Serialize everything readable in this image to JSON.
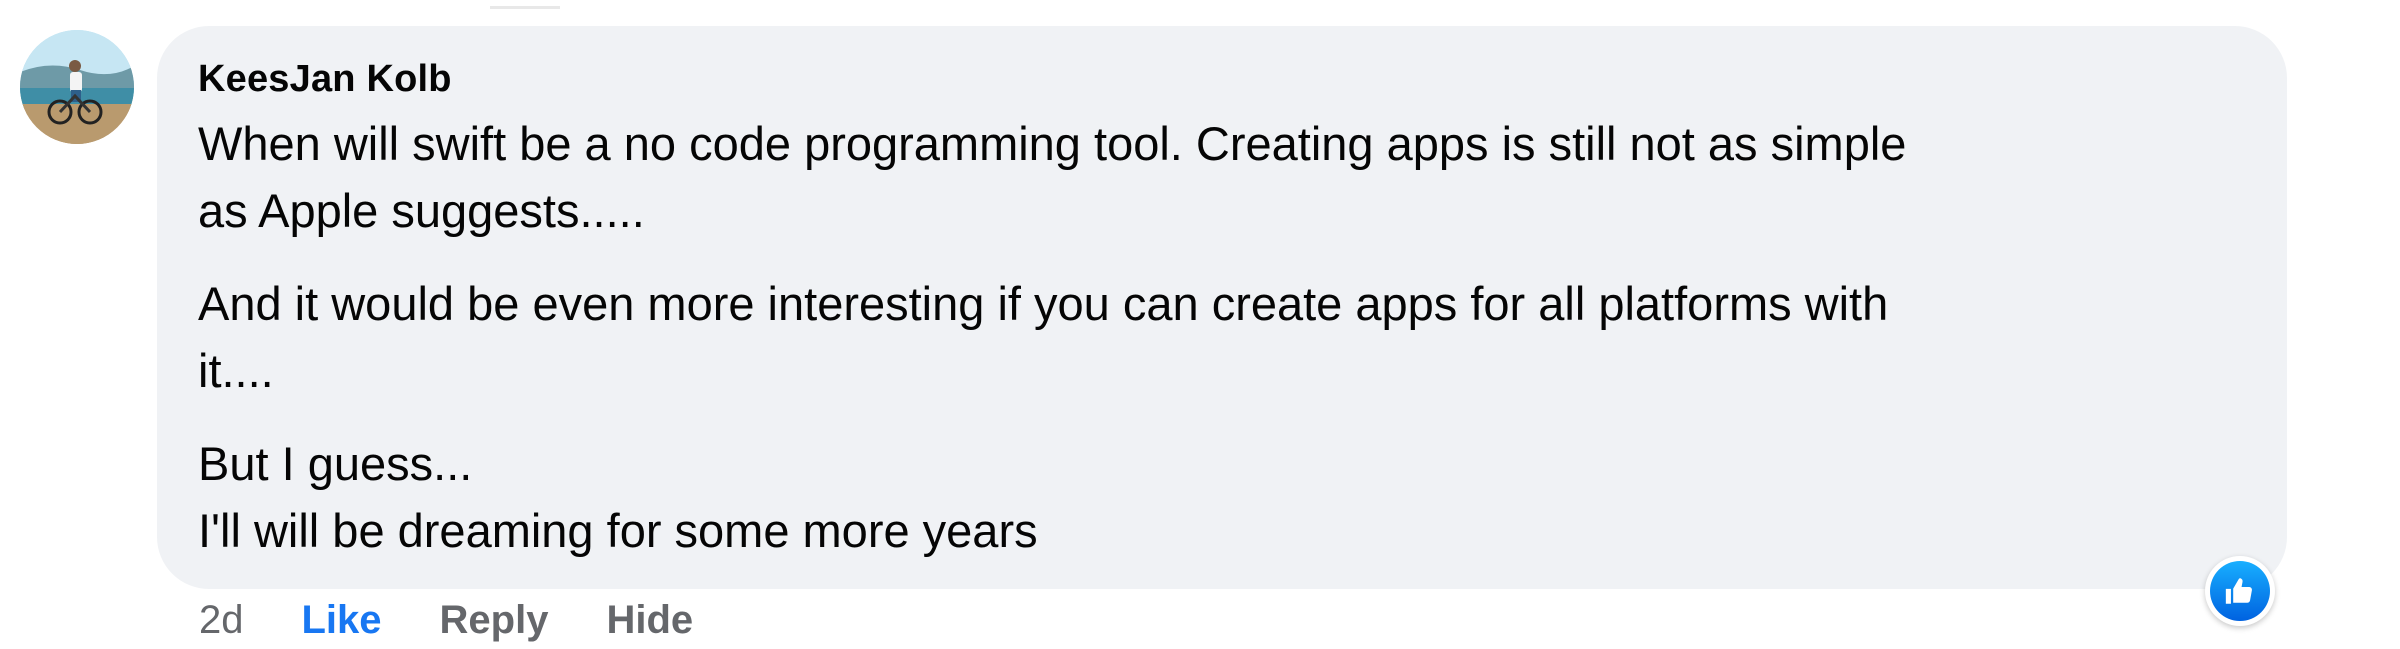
{
  "comment": {
    "author": "KeesJan Kolb",
    "paragraphs": [
      "When will swift be a no code programming tool. Creating apps is still not as simple\nas Apple suggests.....",
      "And it would be even more interesting if you can create apps for all platforms with\nit....",
      "But I guess...\nI'll will be dreaming for some more years"
    ],
    "avatar_icon": "profile-photo",
    "reaction_icon": "thumbs-up-icon",
    "colors": {
      "bubble": "#f0f2f5",
      "like_active": "#1877f2",
      "meta_gray": "#65676b"
    }
  },
  "actions": {
    "time": "2d",
    "like": "Like",
    "reply": "Reply",
    "hide": "Hide"
  }
}
